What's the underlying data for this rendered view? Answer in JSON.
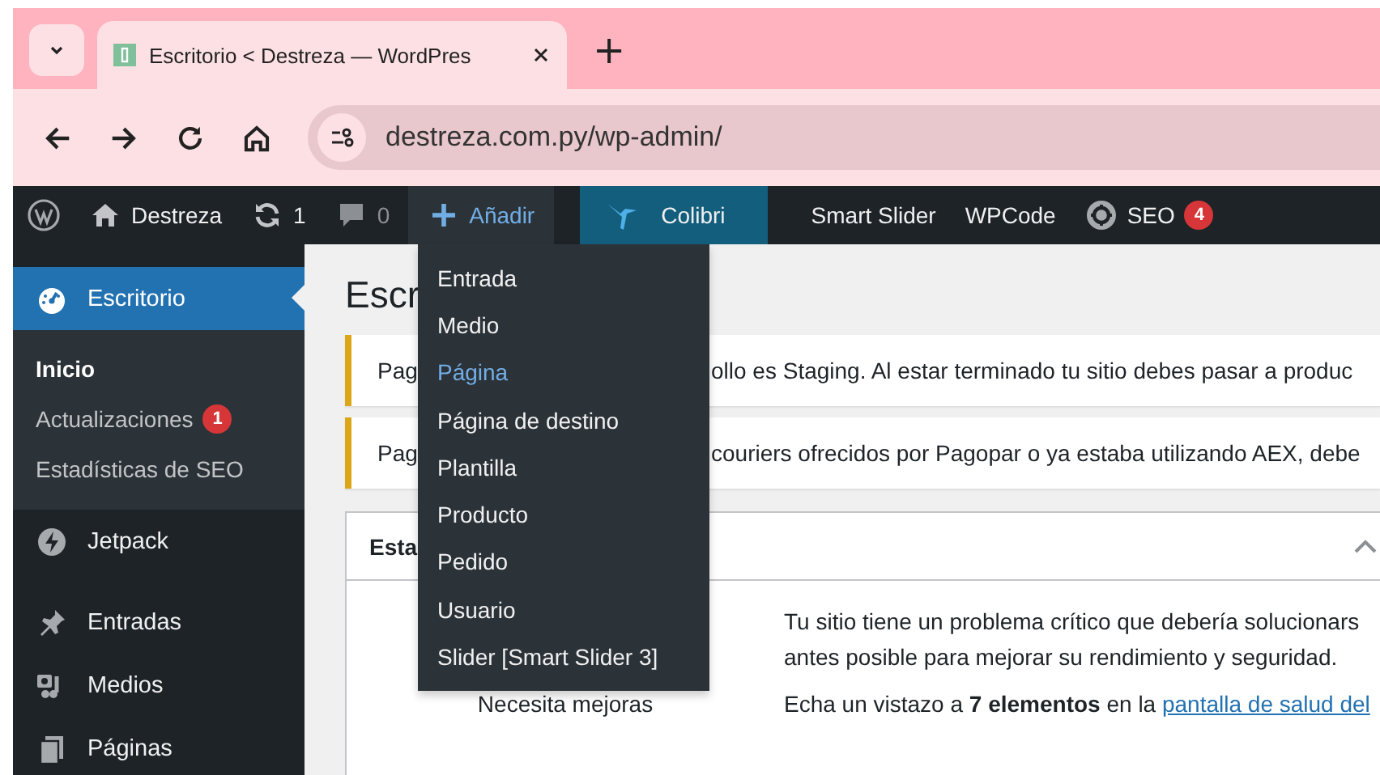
{
  "browser": {
    "tab_title": "Escritorio < Destreza — WordPres",
    "new_tab": "+",
    "url": "destreza.com.py/wp-admin/"
  },
  "admin_bar": [
    {
      "kind": "logo"
    },
    {
      "kind": "site",
      "label": "Destreza"
    },
    {
      "kind": "updates",
      "label": "1"
    },
    {
      "kind": "comments",
      "label": "0"
    },
    {
      "kind": "new",
      "label": "Añadir"
    },
    {
      "kind": "colibri",
      "label": "Colibri"
    },
    {
      "kind": "text",
      "label": "Smart Slider"
    },
    {
      "kind": "text",
      "label": "WPCode"
    },
    {
      "kind": "seo",
      "label": "SEO",
      "badge": "4"
    }
  ],
  "new_menu": [
    {
      "label": "Entrada",
      "selected": false
    },
    {
      "label": "Medio",
      "selected": false
    },
    {
      "label": "Página",
      "selected": true
    },
    {
      "label": "Página de destino",
      "selected": false
    },
    {
      "label": "Plantilla",
      "selected": false
    },
    {
      "label": "Producto",
      "selected": false
    },
    {
      "label": "Pedido",
      "selected": false
    },
    {
      "label": "Usuario",
      "selected": false
    },
    {
      "label": "Slider [Smart Slider 3]",
      "selected": false
    }
  ],
  "sidebar": [
    {
      "label": "Escritorio",
      "kind": "dashboard",
      "current": true,
      "children": [
        {
          "label": "Inicio",
          "selected": true
        },
        {
          "label": "Actualizaciones",
          "badge": "1",
          "selected": false
        },
        {
          "label": "Estadísticas de SEO",
          "selected": false
        }
      ]
    },
    {
      "label": "Jetpack",
      "kind": "jetpack",
      "current": false
    },
    {
      "label": "Entradas",
      "kind": "posts",
      "current": false
    },
    {
      "label": "Medios",
      "kind": "media",
      "current": false
    },
    {
      "label": "Páginas",
      "kind": "pages",
      "current": false
    }
  ],
  "content": {
    "heading": "Escr",
    "notices": [
      {
        "prefix": "Pag",
        "suffix": "ollo es Staging. Al estar terminado tu sitio debes pasar a produc"
      },
      {
        "prefix": "Pag",
        "suffix": "couriers ofrecidos por Pagopar o ya estaba utilizando AEX, debe"
      }
    ],
    "postbox": {
      "title": "Esta",
      "expanded": true,
      "status": "Necesita mejoras",
      "description": "Tu sitio tiene un problema crítico que debería solucionars antes posible para mejorar su rendimiento y seguridad.",
      "review": "Echa un vistazo a **7 elementos** en la",
      "link": "pantalla de salud del"
    }
  }
}
